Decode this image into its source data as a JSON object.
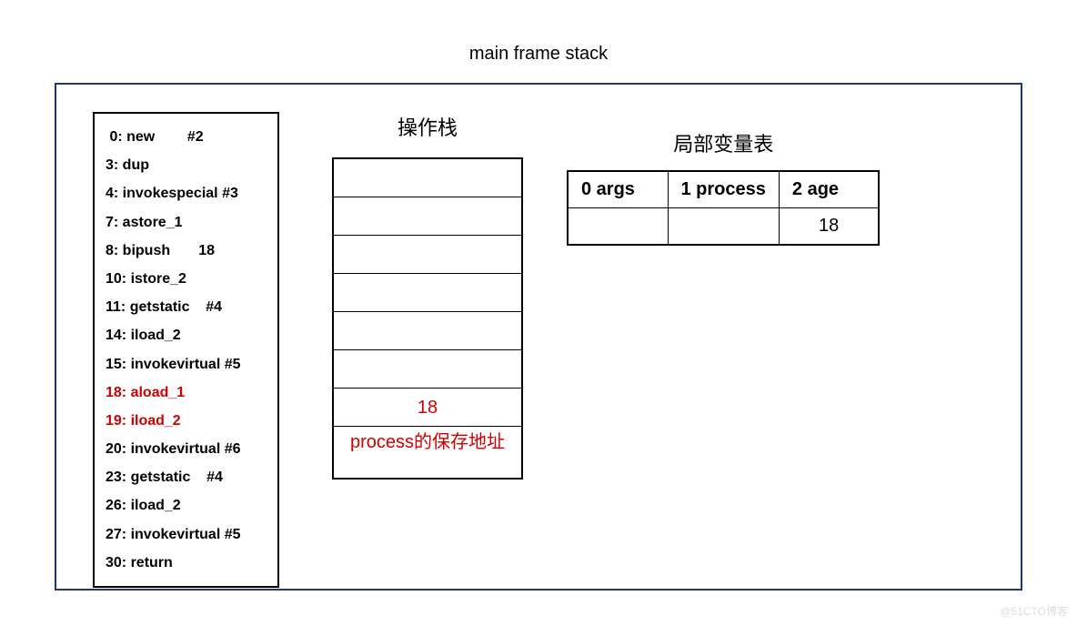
{
  "title": "main frame stack",
  "bytecode": [
    {
      "text": " 0: new        #2",
      "highlight": false
    },
    {
      "text": "3: dup",
      "highlight": false
    },
    {
      "text": "4: invokespecial #3",
      "highlight": false
    },
    {
      "text": "7: astore_1",
      "highlight": false
    },
    {
      "text": "8: bipush       18",
      "highlight": false
    },
    {
      "text": "10: istore_2",
      "highlight": false
    },
    {
      "text": "11: getstatic    #4",
      "highlight": false
    },
    {
      "text": "14: iload_2",
      "highlight": false
    },
    {
      "text": "15: invokevirtual #5",
      "highlight": false
    },
    {
      "text": "18: aload_1",
      "highlight": true
    },
    {
      "text": "19: iload_2",
      "highlight": true
    },
    {
      "text": "20: invokevirtual #6",
      "highlight": false
    },
    {
      "text": "23: getstatic    #4",
      "highlight": false
    },
    {
      "text": "26: iload_2",
      "highlight": false
    },
    {
      "text": "27: invokevirtual #5",
      "highlight": false
    },
    {
      "text": "30: return",
      "highlight": false
    }
  ],
  "operand_stack": {
    "title": "操作栈",
    "cells": [
      {
        "text": "",
        "tall": false
      },
      {
        "text": "",
        "tall": false
      },
      {
        "text": "",
        "tall": false
      },
      {
        "text": "",
        "tall": false
      },
      {
        "text": "",
        "tall": false
      },
      {
        "text": "",
        "tall": false
      },
      {
        "text": "18",
        "tall": false
      },
      {
        "text": "process的保存地址",
        "tall": true
      }
    ]
  },
  "local_vars": {
    "title": "局部变量表",
    "headers": [
      "0 args",
      "1 process",
      "2 age"
    ],
    "values": [
      "",
      "",
      "18"
    ]
  },
  "watermark": "@51CTO博客"
}
